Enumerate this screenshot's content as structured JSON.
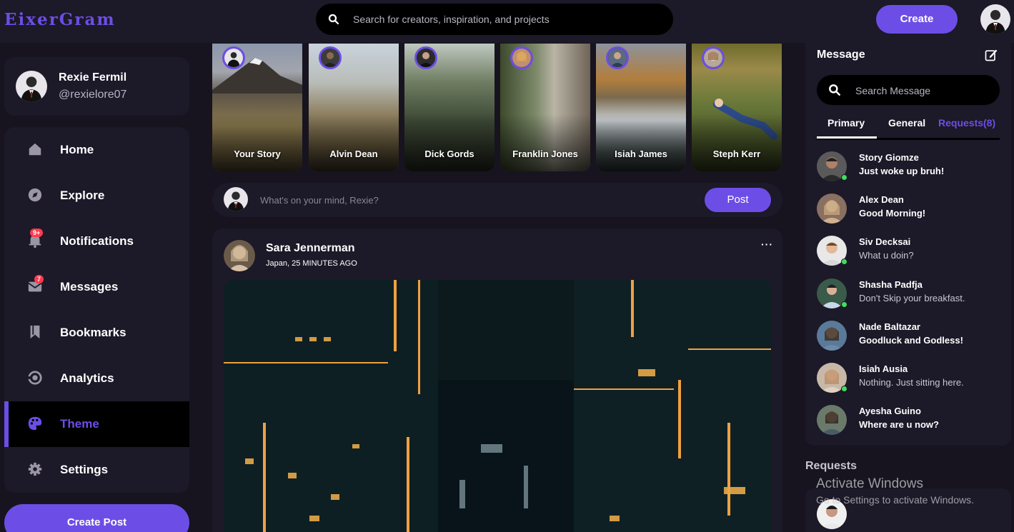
{
  "app": {
    "logo": "EixerGram",
    "accent": "#6c4ee6",
    "background": "#17141f",
    "card": "#1c1928"
  },
  "header": {
    "search_placeholder": "Search for creators, inspiration, and projects",
    "create_label": "Create"
  },
  "profile": {
    "name": "Rexie Fermil",
    "handle": "@rexielore07"
  },
  "nav": {
    "items": [
      {
        "label": "Home",
        "icon": "home-icon"
      },
      {
        "label": "Explore",
        "icon": "compass-icon"
      },
      {
        "label": "Notifications",
        "icon": "bell-icon",
        "badge": "9+"
      },
      {
        "label": "Messages",
        "icon": "envelope-icon",
        "badge": "7"
      },
      {
        "label": "Bookmarks",
        "icon": "bookmark-icon"
      },
      {
        "label": "Analytics",
        "icon": "analytics-icon"
      },
      {
        "label": "Theme",
        "icon": "palette-icon",
        "active": true
      },
      {
        "label": "Settings",
        "icon": "gear-icon"
      }
    ],
    "create_post_label": "Create Post"
  },
  "stories": [
    {
      "name": "Your Story"
    },
    {
      "name": "Alvin Dean"
    },
    {
      "name": "Dick Gords"
    },
    {
      "name": "Franklin Jones"
    },
    {
      "name": "Isiah James"
    },
    {
      "name": "Steph Kerr"
    }
  ],
  "composer": {
    "placeholder": "What's on your mind, Rexie?",
    "post_label": "Post"
  },
  "feed": {
    "author": "Sara Jennerman",
    "meta": "Japan, 25 MINUTES AGO",
    "more": "···"
  },
  "messages": {
    "title": "Message",
    "search_placeholder": "Search Message",
    "tabs": [
      "Primary",
      "General",
      "Requests(8)"
    ],
    "active_tab": "Primary",
    "chats": [
      {
        "name": "Story Giomze",
        "text": "Just woke up bruh!",
        "online": true,
        "unread": true
      },
      {
        "name": "Alex Dean",
        "text": "Good Morning!",
        "online": false,
        "unread": true
      },
      {
        "name": "Siv Decksai",
        "text": "What u doin?",
        "online": true,
        "unread": false
      },
      {
        "name": "Shasha Padfja",
        "text": "Don't Skip your breakfast.",
        "online": true,
        "unread": false
      },
      {
        "name": "Nade Baltazar",
        "text": "Goodluck and Godless!",
        "online": false,
        "unread": true
      },
      {
        "name": "Isiah Ausia",
        "text": "Nothing. Just sitting here.",
        "online": true,
        "unread": false
      },
      {
        "name": "Ayesha Guino",
        "text": "Where are u now?",
        "online": false,
        "unread": true
      }
    ]
  },
  "requests": {
    "title": "Requests"
  },
  "watermark": {
    "line1": "Activate Windows",
    "line2": "Go to Settings to activate Windows."
  }
}
